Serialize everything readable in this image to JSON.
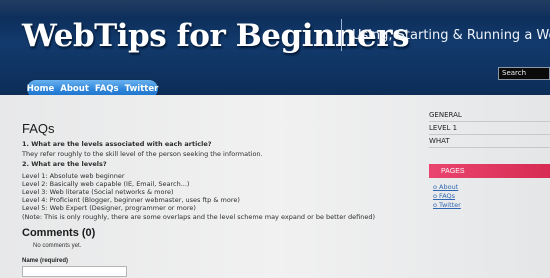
{
  "header": {
    "title": "WebTips for Beginners",
    "tagline": "Using, Starting & Running a Website",
    "search_placeholder": "Search"
  },
  "nav": {
    "items": [
      "Home",
      "About",
      "FAQs",
      "Twitter"
    ]
  },
  "main": {
    "heading": "FAQs",
    "question_1": "1. What are the levels associated with each article?",
    "answer_1": "They refer roughly to the skill level of the person seeking the information.",
    "question_2": "2. What are the levels?",
    "levels": [
      "Level 1: Absolute web beginner",
      "Level 2: Basically web capable (IE, Email, Search...)",
      "Level 3: Web literate (Social networks & more)",
      "Level 4: Proficient (Blogger, beginner webmaster, uses ftp & more)",
      "Level 5: Web Expert (Designer, programmer or more)"
    ],
    "note": "(Note: This is only roughly, there are some overlaps and the level scheme may expand or be better defined)"
  },
  "comments": {
    "heading": "Comments (0)",
    "none_text": "No comments yet.",
    "name_label": "Name (required)"
  },
  "sidebar": {
    "categories": [
      "GENERAL",
      "LEVEL 1",
      "WHAT"
    ],
    "pages_heading": "PAGES",
    "pages": [
      "About",
      "FAQs",
      "Twitter"
    ]
  },
  "colors": {
    "header_bg": "#0d2d58",
    "nav_blue": "#2c84d9",
    "pages_pink": "#d72b53",
    "link_blue": "#2f66b3"
  }
}
